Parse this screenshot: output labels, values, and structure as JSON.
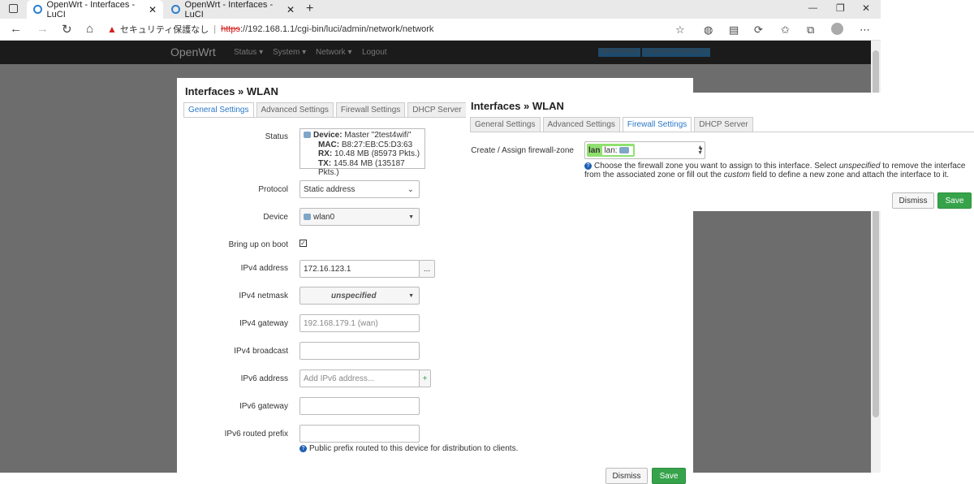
{
  "browser": {
    "tabs": [
      {
        "label": "OpenWrt - Interfaces - LuCI",
        "active": true
      },
      {
        "label": "OpenWrt - Interfaces - LuCI",
        "active": false
      }
    ],
    "new_tab": "+",
    "window_controls": {
      "minimize": "—",
      "restore": "❐",
      "close": "✕"
    },
    "security_label": "セキュリティ保護なし",
    "url_scheme": "https",
    "url_rest": "://192.168.1.1/cgi-bin/luci/admin/network/network"
  },
  "openwrt": {
    "brand": "OpenWrt",
    "menu": [
      "Status ▾",
      "System ▾",
      "Network ▾",
      "Logout"
    ],
    "badges": [
      "REFRESHING",
      "UNSAVED CHANGES: 5"
    ]
  },
  "modal_general": {
    "title": "Interfaces » WLAN",
    "tabs": [
      "General Settings",
      "Advanced Settings",
      "Firewall Settings",
      "DHCP Server"
    ],
    "active_tab": "General Settings",
    "status": {
      "label": "Status",
      "device_label": "Device:",
      "device_value": "Master \"2test4wifi\"",
      "mac_label": "MAC:",
      "mac_value": "B8:27:EB:C5:D3:63",
      "rx_label": "RX:",
      "rx_value": "10.48 MB (85973 Pkts.)",
      "tx_label": "TX:",
      "tx_value": "145.84 MB (135187 Pkts.)"
    },
    "protocol": {
      "label": "Protocol",
      "value": "Static address"
    },
    "device": {
      "label": "Device",
      "value": "wlan0"
    },
    "bring_up": {
      "label": "Bring up on boot",
      "checked": true
    },
    "ipv4_address": {
      "label": "IPv4 address",
      "value": "172.16.123.1",
      "button": "..."
    },
    "ipv4_netmask": {
      "label": "IPv4 netmask",
      "value": "unspecified"
    },
    "ipv4_gateway": {
      "label": "IPv4 gateway",
      "placeholder": "192.168.179.1 (wan)"
    },
    "ipv4_broadcast": {
      "label": "IPv4 broadcast",
      "value": ""
    },
    "ipv6_address": {
      "label": "IPv6 address",
      "placeholder": "Add IPv6 address...",
      "button": "+"
    },
    "ipv6_gateway": {
      "label": "IPv6 gateway",
      "value": ""
    },
    "ipv6_prefix": {
      "label": "IPv6 routed prefix",
      "value": "",
      "hint": "Public prefix routed to this device for distribution to clients."
    },
    "buttons": {
      "dismiss": "Dismiss",
      "save": "Save"
    }
  },
  "modal_firewall": {
    "title": "Interfaces » WLAN",
    "tabs": [
      "General Settings",
      "Advanced Settings",
      "Firewall Settings",
      "DHCP Server"
    ],
    "active_tab": "Firewall Settings",
    "zone": {
      "label": "Create / Assign firewall-zone",
      "zone_name": "lan",
      "zone_member": "lan:"
    },
    "hint_1": "Choose the firewall zone you want to assign to this interface. Select ",
    "hint_em1": "unspecified",
    "hint_2": " to remove the interface from the associated zone or fill out the ",
    "hint_em2": "custom",
    "hint_3": " field to define a new zone and attach the interface to it.",
    "buttons": {
      "dismiss": "Dismiss",
      "save": "Save"
    }
  },
  "colors": {
    "accent": "#2a78c8",
    "save": "#36a34b",
    "zone": "#90e070"
  }
}
